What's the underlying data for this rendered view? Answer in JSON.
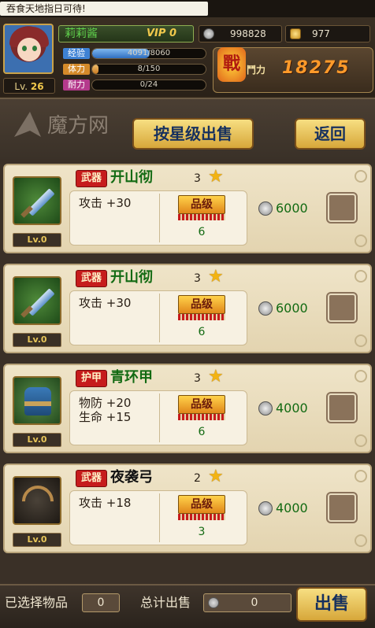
{
  "marquee": {
    "text": "吞食天地指日可待!"
  },
  "player": {
    "name": "莉莉酱",
    "vip": "VIP 0",
    "level_prefix": "Lv.",
    "level": "26",
    "silver": "998828",
    "gold": "977",
    "exp_label": "经验",
    "exp_text": "4091/8060",
    "exp_fraction": 0.507,
    "stamina_label": "体力",
    "stamina_text": "8/150",
    "stamina_fraction": 0.053,
    "endurance_label": "耐力",
    "endurance_text": "0/24",
    "endurance_fraction": 0,
    "power_badge": "戰",
    "power_label": "鬥力",
    "power_value": "18275"
  },
  "toolbar": {
    "watermark": "魔方网",
    "sell_by_star_label": "按星级出售",
    "back_label": "返回"
  },
  "grade_label": "品级",
  "items": [
    {
      "type": "武器",
      "name": "开山彻",
      "stars": "3",
      "stats": [
        "攻击 +30"
      ],
      "grade": "6",
      "price": "6000",
      "level": "Lv.0",
      "icon": "sword-icon"
    },
    {
      "type": "武器",
      "name": "开山彻",
      "stars": "3",
      "stats": [
        "攻击 +30"
      ],
      "grade": "6",
      "price": "6000",
      "level": "Lv.0",
      "icon": "sword-icon"
    },
    {
      "type": "护甲",
      "name": "青环甲",
      "stars": "3",
      "stats": [
        "物防 +20",
        "生命 +15"
      ],
      "grade": "6",
      "price": "4000",
      "level": "Lv.0",
      "icon": "armor-icon"
    },
    {
      "type": "武器",
      "name": "夜袭弓",
      "stars": "2",
      "stats": [
        "攻击 +18"
      ],
      "grade": "3",
      "price": "4000",
      "level": "Lv.0",
      "icon": "bow-icon"
    }
  ],
  "footer": {
    "selected_label": "已选择物品",
    "selected_count": "0",
    "total_label": "总计出售",
    "total_value": "0",
    "sell_label": "出售"
  },
  "colors": {
    "accent_green": "#126a12",
    "tag_red": "#c61c1c",
    "power_orange": "#ff9a2a"
  }
}
